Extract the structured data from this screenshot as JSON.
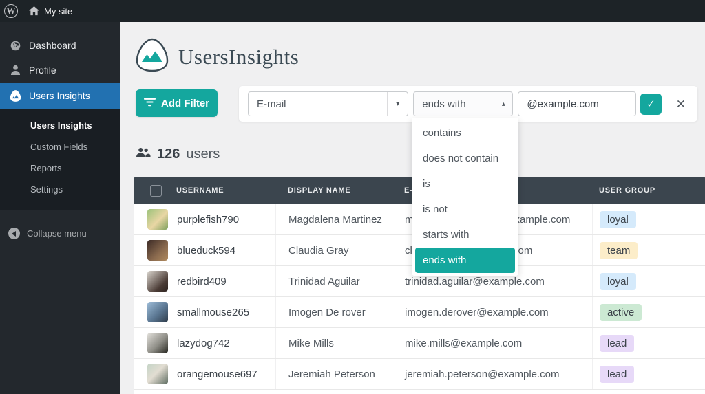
{
  "topbar": {
    "site_name": "My site"
  },
  "sidebar": {
    "items": [
      {
        "label": "Dashboard"
      },
      {
        "label": "Profile"
      },
      {
        "label": "Users Insights"
      }
    ],
    "submenu": [
      "Users Insights",
      "Custom Fields",
      "Reports",
      "Settings"
    ],
    "collapse_label": "Collapse menu"
  },
  "brand": {
    "logo_text": "UsersInsights"
  },
  "filter": {
    "add_filter_label": "Add Filter",
    "field_value": "E-mail",
    "operator_value": "ends with",
    "operator_options": [
      "contains",
      "does not contain",
      "is",
      "is not",
      "starts with",
      "ends with"
    ],
    "value_input": "@example.com"
  },
  "users_summary": {
    "count": "126",
    "label": "users"
  },
  "table": {
    "headers": [
      "USERNAME",
      "DISPLAY NAME",
      "E-MAIL",
      "USER GROUP"
    ],
    "rows": [
      {
        "username": "purplefish790",
        "display_name": "Magdalena Martinez",
        "email": "magdalena.martinez@example.com",
        "group": "loyal",
        "group_color": "#d5eafb"
      },
      {
        "username": "blueduck594",
        "display_name": "Claudia Gray",
        "email": "claudia.gray@example.com",
        "group": "team",
        "group_color": "#fcedc9"
      },
      {
        "username": "redbird409",
        "display_name": "Trinidad Aguilar",
        "email": "trinidad.aguilar@example.com",
        "group": "loyal",
        "group_color": "#d5eafb"
      },
      {
        "username": "smallmouse265",
        "display_name": "Imogen De rover",
        "email": "imogen.derover@example.com",
        "group": "active",
        "group_color": "#cce9d3"
      },
      {
        "username": "lazydog742",
        "display_name": "Mike Mills",
        "email": "mike.mills@example.com",
        "group": "lead",
        "group_color": "#e7d9f8"
      },
      {
        "username": "orangemouse697",
        "display_name": "Jeremiah Peterson",
        "email": "jeremiah.peterson@example.com",
        "group": "lead",
        "group_color": "#e7d9f8"
      }
    ]
  },
  "colors": {
    "accent_teal": "#14a79e",
    "active_blue": "#2271b1",
    "header_dark": "#3b454e"
  }
}
